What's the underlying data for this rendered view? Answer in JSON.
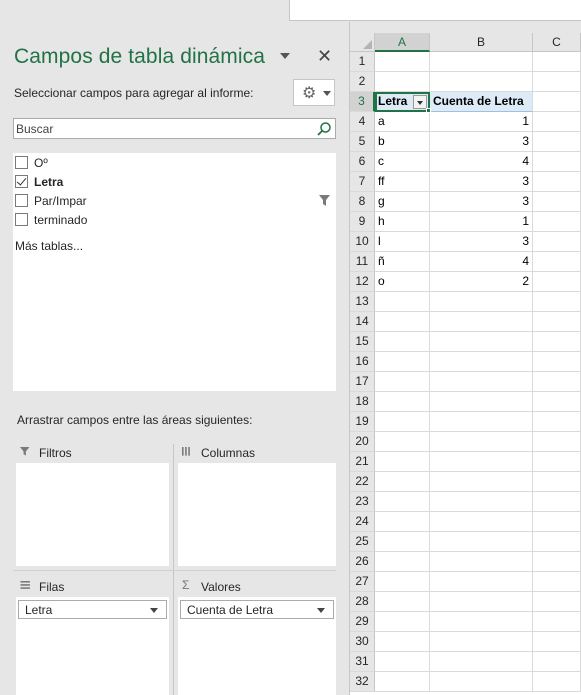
{
  "panel": {
    "title": "Campos de tabla dinámica",
    "subtitle": "Seleccionar campos para agregar al informe:",
    "search_placeholder": "Buscar",
    "fields": [
      {
        "label": "Oº",
        "checked": false,
        "bold": false,
        "filtered": false
      },
      {
        "label": "Letra",
        "checked": true,
        "bold": true,
        "filtered": false
      },
      {
        "label": "Par/Impar",
        "checked": false,
        "bold": false,
        "filtered": true
      },
      {
        "label": "terminado",
        "checked": false,
        "bold": false,
        "filtered": false
      }
    ],
    "more_tables": "Más tablas...",
    "drag_hint": "Arrastrar campos entre las áreas siguientes:",
    "areas": {
      "filters": {
        "label": "Filtros",
        "icon": "filter-icon"
      },
      "columns": {
        "label": "Columnas",
        "icon": "columns-icon"
      },
      "rows": {
        "label": "Filas",
        "icon": "rows-icon",
        "items": [
          "Letra"
        ]
      },
      "values": {
        "label": "Valores",
        "icon": "sigma-icon",
        "items": [
          "Cuenta de Letra"
        ]
      }
    }
  },
  "sheet": {
    "columns": [
      "A",
      "B",
      "C"
    ],
    "selected_column": "A",
    "selected_row": 3,
    "row_numbers": [
      1,
      2,
      3,
      4,
      5,
      6,
      7,
      8,
      9,
      10,
      11,
      12,
      13,
      14,
      15,
      16,
      17,
      18,
      19,
      20,
      21,
      22,
      23,
      24,
      25,
      26,
      27,
      28,
      29,
      30,
      31,
      32
    ],
    "pivot_header": {
      "row": 3,
      "a": "Letra",
      "b": "Cuenta de Letra"
    },
    "pivot_rows": [
      {
        "row": 4,
        "a": "a",
        "b": "1"
      },
      {
        "row": 5,
        "a": "b",
        "b": "3"
      },
      {
        "row": 6,
        "a": "c",
        "b": "4"
      },
      {
        "row": 7,
        "a": "ff",
        "b": "3"
      },
      {
        "row": 8,
        "a": "g",
        "b": "3"
      },
      {
        "row": 9,
        "a": "h",
        "b": "1"
      },
      {
        "row": 10,
        "a": "l",
        "b": "3"
      },
      {
        "row": 11,
        "a": "ñ",
        "b": "4"
      },
      {
        "row": 12,
        "a": "o",
        "b": "2"
      }
    ]
  },
  "colors": {
    "accent": "#217346",
    "pivot_header_bg": "#ddebf7"
  }
}
